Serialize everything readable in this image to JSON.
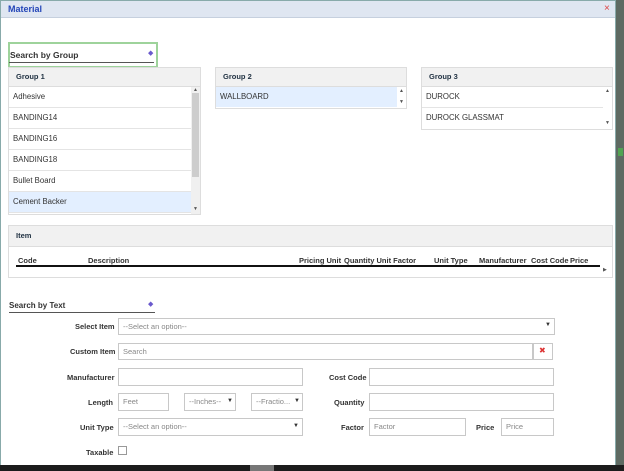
{
  "window": {
    "title": "Material",
    "close_glyph": "×"
  },
  "search_by_group": {
    "label": "Search by Group",
    "arrow_glyph": "◆"
  },
  "group1": {
    "title": "Group 1",
    "items": [
      "Adhesive",
      "BANDING14",
      "BANDING16",
      "BANDING18",
      "Bullet Board",
      "Cement Backer"
    ],
    "selected_index": 5
  },
  "group2": {
    "title": "Group 2",
    "items": [
      "WALLBOARD"
    ]
  },
  "group3": {
    "title": "Group 3",
    "items": [
      "DUROCK",
      "DUROCK GLASSMAT"
    ]
  },
  "item_table": {
    "title": "Item",
    "columns": [
      "Code",
      "Description",
      "Pricing Unit",
      "Quantity Unit Factor",
      "Unit Type",
      "Manufacturer",
      "Cost Code",
      "Price"
    ]
  },
  "search_by_text": {
    "label": "Search by Text",
    "arrow_glyph": "◆",
    "select_item": {
      "label": "Select Item",
      "placeholder": "--Select an option--"
    },
    "custom_item": {
      "label": "Custom Item",
      "placeholder": "Search",
      "clear_glyph": "✖"
    },
    "manufacturer": {
      "label": "Manufacturer",
      "value": ""
    },
    "cost_code": {
      "label": "Cost Code",
      "value": ""
    },
    "length": {
      "label": "Length",
      "feet_placeholder": "Feet",
      "inches_option": "--Inches--",
      "fraction_option": "--Fractio..."
    },
    "quantity": {
      "label": "Quantity",
      "value": ""
    },
    "unit_type": {
      "label": "Unit Type",
      "placeholder": "--Select an option--"
    },
    "factor": {
      "label": "Factor",
      "placeholder": "Factor"
    },
    "price": {
      "label": "Price",
      "placeholder": "Price"
    },
    "taxable": {
      "label": "Taxable",
      "checked": false
    }
  },
  "colors": {
    "title_text": "#2446b8",
    "selected_row": "#e3efff",
    "highlight_border": "#9ed39b",
    "close_icon": "#dd4444"
  }
}
